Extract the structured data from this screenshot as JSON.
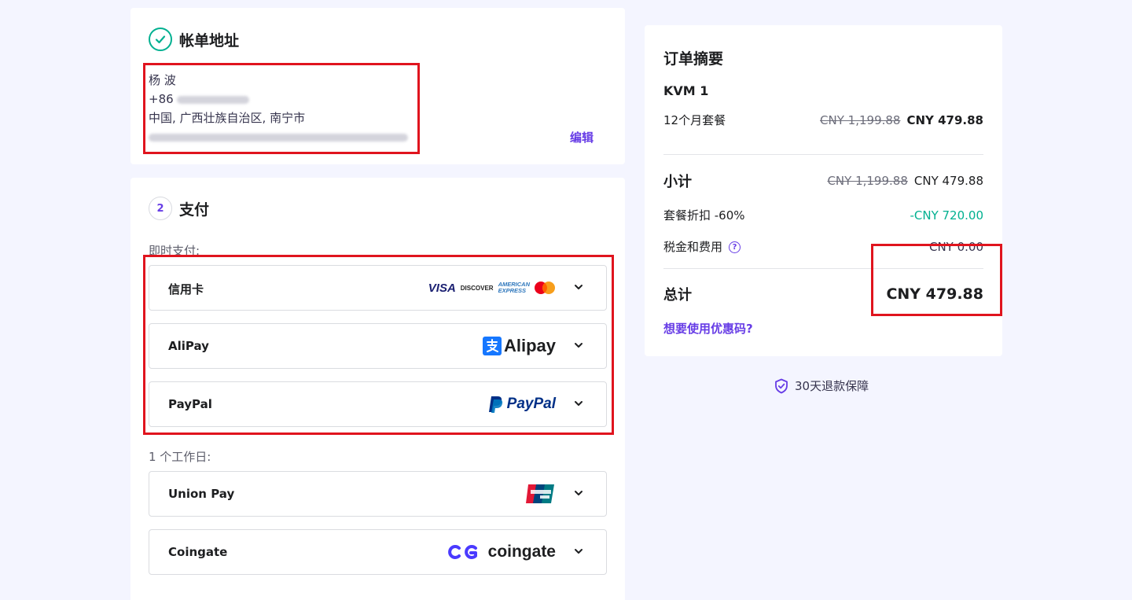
{
  "billing": {
    "title": "帐单地址",
    "name": "杨 波",
    "phone_prefix": "+86",
    "region": "中国, 广西壮族自治区, 南宁市",
    "edit_label": "编辑"
  },
  "payment": {
    "step_number": "2",
    "title": "支付",
    "instant_label": "即时支付:",
    "delayed_label": "1 个工作日:",
    "instant_methods": [
      {
        "name": "信用卡",
        "logo": "card-brands"
      },
      {
        "name": "AliPay",
        "logo": "Alipay"
      },
      {
        "name": "PayPal",
        "logo": "PayPal"
      }
    ],
    "delayed_methods": [
      {
        "name": "Union Pay",
        "logo": "unionpay"
      },
      {
        "name": "Coingate",
        "logo": "coingate"
      }
    ],
    "card_brands": {
      "visa": "VISA",
      "discover": "DISCOVER",
      "amex_line1": "AMERICAN",
      "amex_line2": "EXPRESS"
    },
    "alipay_logo_text": "Alipay",
    "paypal_logo_text": "PayPal",
    "coingate_logo_text": "coingate"
  },
  "summary": {
    "title": "订单摘要",
    "product": "KVM 1",
    "plan": "12个月套餐",
    "plan_old_price": "CNY 1,199.88",
    "plan_price": "CNY 479.88",
    "subtotal_label": "小计",
    "subtotal_old": "CNY 1,199.88",
    "subtotal": "CNY 479.88",
    "discount_label": "套餐折扣 -60%",
    "discount": "-CNY 720.00",
    "tax_label": "税金和费用",
    "tax": "CNY 0.00",
    "total_label": "总计",
    "total": "CNY 479.88",
    "coupon_link": "想要使用优惠码?"
  },
  "guarantee": "30天退款保障",
  "colors": {
    "accent": "#673de6",
    "success": "#00b090",
    "highlight": "#e0141e",
    "background": "#f4f5ff"
  }
}
